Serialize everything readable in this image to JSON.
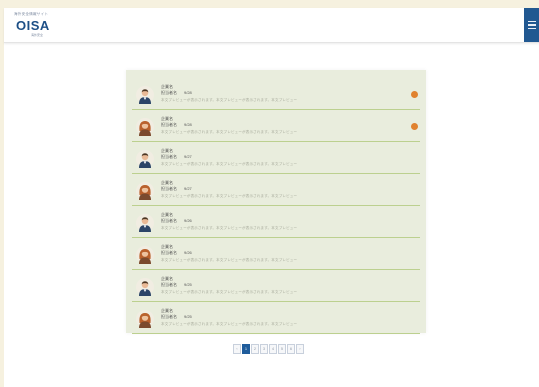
{
  "header": {
    "logo_tagline": "海外安全情報サイト",
    "logo_text": "OISA",
    "logo_sub": "海外安全",
    "brand_color": "#1d4f86",
    "menu_icon": "hamburger-menu-icon"
  },
  "messages": [
    {
      "title": "企業名",
      "sender": "担当者名",
      "date": "9/28",
      "snippet": "本文プレビューが表示されます。本文プレビューが表示されます。本文プレビュー",
      "avatar": "male",
      "unread": true
    },
    {
      "title": "企業名",
      "sender": "担当者名",
      "date": "9/28",
      "snippet": "本文プレビューが表示されます。本文プレビューが表示されます。本文プレビュー",
      "avatar": "female",
      "unread": true
    },
    {
      "title": "企業名",
      "sender": "担当者名",
      "date": "9/27",
      "snippet": "本文プレビューが表示されます。本文プレビューが表示されます。本文プレビュー",
      "avatar": "male",
      "unread": false
    },
    {
      "title": "企業名",
      "sender": "担当者名",
      "date": "9/27",
      "snippet": "本文プレビューが表示されます。本文プレビューが表示されます。本文プレビュー",
      "avatar": "female",
      "unread": false
    },
    {
      "title": "企業名",
      "sender": "担当者名",
      "date": "9/26",
      "snippet": "本文プレビューが表示されます。本文プレビューが表示されます。本文プレビュー",
      "avatar": "male",
      "unread": false
    },
    {
      "title": "企業名",
      "sender": "担当者名",
      "date": "9/26",
      "snippet": "本文プレビューが表示されます。本文プレビューが表示されます。本文プレビュー",
      "avatar": "female",
      "unread": false
    },
    {
      "title": "企業名",
      "sender": "担当者名",
      "date": "9/25",
      "snippet": "本文プレビューが表示されます。本文プレビューが表示されます。本文プレビュー",
      "avatar": "male",
      "unread": false
    },
    {
      "title": "企業名",
      "sender": "担当者名",
      "date": "9/25",
      "snippet": "本文プレビューが表示されます。本文プレビューが表示されます。本文プレビュー",
      "avatar": "female",
      "unread": false
    }
  ],
  "unread_color": "#e0822f",
  "pagination": {
    "pages": [
      "‹",
      "1",
      "2",
      "3",
      "4",
      "5",
      "6",
      "›"
    ],
    "active": "1"
  }
}
